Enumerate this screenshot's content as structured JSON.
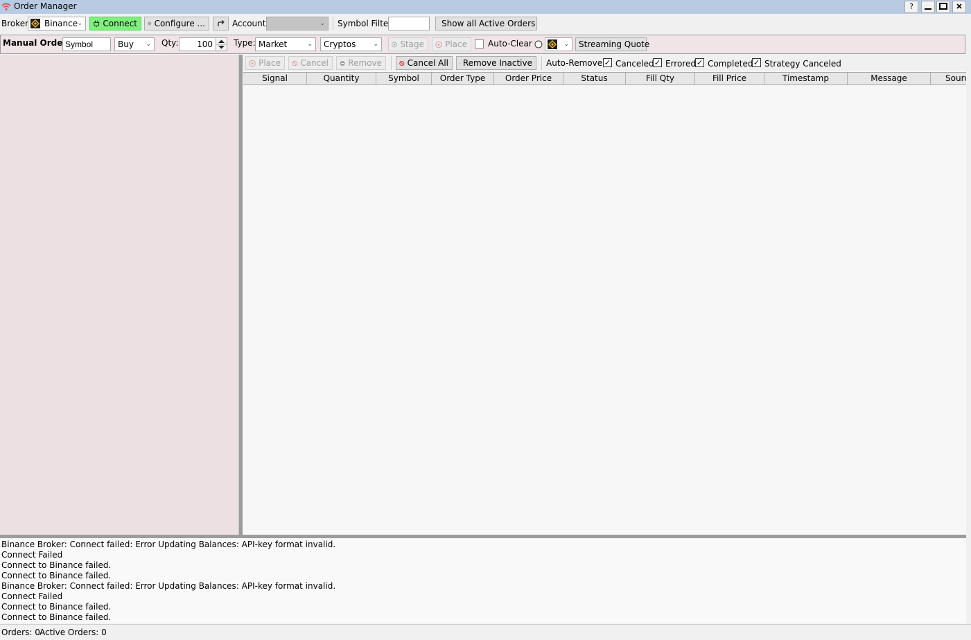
{
  "window": {
    "title": "Order Manager",
    "help_label": "?",
    "minimize_label": "—",
    "maximize_label": "▭",
    "close_label": "×"
  },
  "toolbar": {
    "broker_label": "Broker",
    "broker_value": "Binance",
    "connect_label": "Connect",
    "configure_label": "Configure ...",
    "account_label": "Account",
    "account_value": "",
    "symbol_filter_label": "Symbol Filter",
    "symbol_filter_value": "",
    "show_active_label": "Show all Active Orders"
  },
  "manual_order": {
    "label": "Manual Order:",
    "symbol_value": "Symbol",
    "side_value": "Buy",
    "qty_label": "Qty:",
    "qty_value": "100",
    "type_label": "Type:",
    "type_value": "Market",
    "asset_class_value": "Cryptos",
    "stage_label": "Stage",
    "place_label": "Place",
    "auto_clear_label": "Auto-Clear",
    "streaming_quote_label": "Streaming Quote"
  },
  "order_toolbar": {
    "place_label": "Place",
    "cancel_label": "Cancel",
    "remove_label": "Remove",
    "cancel_all_label": "Cancel All",
    "remove_inactive_label": "Remove Inactive",
    "auto_remove_label": "Auto-Remove:",
    "canceled_label": "Canceled",
    "errored_label": "Errored",
    "completed_label": "Completed",
    "strategy_canceled_label": "Strategy Canceled"
  },
  "grid": {
    "columns": [
      "Signal",
      "Quantity",
      "Symbol",
      "Order Type",
      "Order Price",
      "Status",
      "Fill Qty",
      "Fill Price",
      "Timestamp",
      "Message",
      "Sourc"
    ]
  },
  "log": [
    "Binance Broker: Connect failed: Error Updating Balances: API-key format invalid.",
    "Connect Failed",
    "Connect to Binance failed.",
    "Connect to Binance failed.",
    "Binance Broker: Connect failed: Error Updating Balances: API-key format invalid.",
    "Connect Failed",
    "Connect to Binance failed.",
    "Connect to Binance failed."
  ],
  "status": {
    "orders_text": "Orders: 0",
    "active_orders_text": "Active Orders: 0"
  },
  "colors": {
    "connect_bg": "#7ef07e",
    "left_panel_bg": "#ede0e2",
    "binance_yellow": "#f0b90b",
    "title_bar": "#b9cbe3"
  }
}
